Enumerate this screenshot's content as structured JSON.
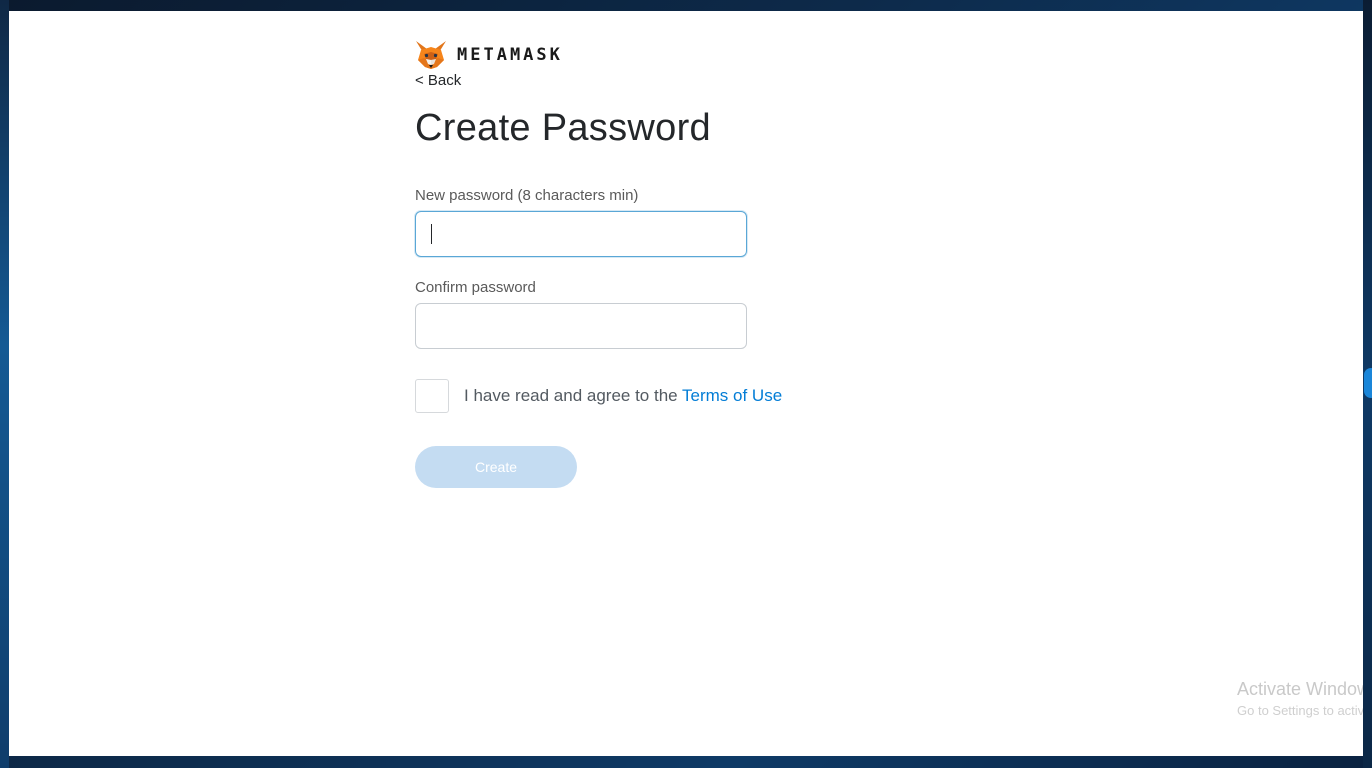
{
  "header": {
    "brand": "METAMASK",
    "logo_icon": "fox-icon",
    "back_label": "< Back"
  },
  "main": {
    "title": "Create Password",
    "new_password": {
      "label": "New password (8 characters min)",
      "value": "",
      "focused": true
    },
    "confirm_password": {
      "label": "Confirm password",
      "value": ""
    },
    "terms": {
      "checked": false,
      "text": "I have read and agree to the",
      "link_label": "Terms of Use"
    },
    "create_button": {
      "label": "Create",
      "disabled": true
    }
  },
  "os_watermark": {
    "title": "Activate Windows",
    "subtitle": "Go to Settings to activate Windows."
  },
  "colors": {
    "link": "#037dd6",
    "focus_border": "#5aa7d6",
    "button_disabled_bg": "#c4dcf2",
    "title_text": "#24272a"
  }
}
